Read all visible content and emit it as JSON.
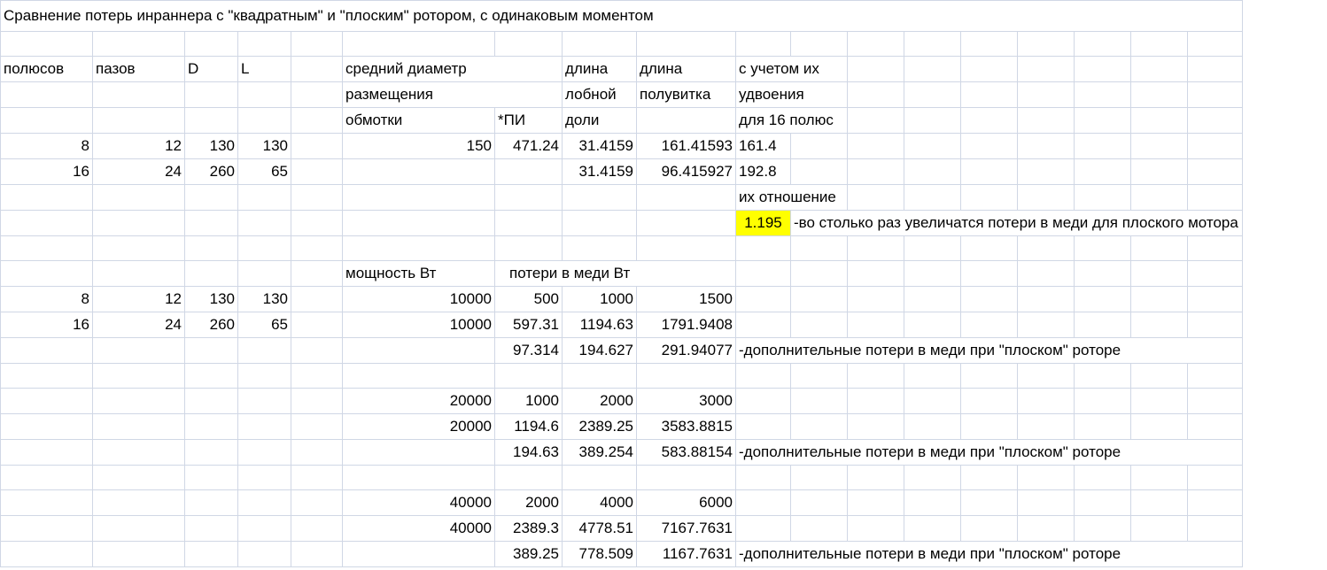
{
  "title": "Сравнение потерь инраннера с \"квадратным\" и \"плоским\" ротором, с одинаковым моментом",
  "headers": {
    "poles": "полюсов",
    "slots": "пазов",
    "d": "D",
    "l": "L",
    "mean_diameter_1": "средний диаметр",
    "mean_diameter_2": "размещения",
    "mean_diameter_3": "обмотки",
    "pi": "*ПИ",
    "len1_1": "длина",
    "len1_2": "лобной",
    "len1_3": "доли",
    "len2_1": "длина",
    "len2_2": "полувитка",
    "double_1": "с учетом их",
    "double_2": "удвоения",
    "double_3": "для 16 полюс"
  },
  "geometry_rows": [
    {
      "poles": "8",
      "slots": "12",
      "d": "130",
      "l": "130",
      "mean_d": "150",
      "pi": "471.24",
      "end_len": "31.4159",
      "half_turn": "161.41593",
      "doubled": "161.4"
    },
    {
      "poles": "16",
      "slots": "24",
      "d": "260",
      "l": "65",
      "mean_d": "",
      "pi": "",
      "end_len": "31.4159",
      "half_turn": "96.415927",
      "doubled": "192.8"
    }
  ],
  "ratio_label": "их отношение",
  "ratio_value": "1.195",
  "ratio_note": "-во столько раз увеличатся потери в меди для плоского мотора",
  "power_header": "мощность Вт",
  "loss_header": "потери в меди Вт",
  "motor_rows": [
    {
      "poles": "8",
      "slots": "12",
      "d": "130",
      "l": "130"
    },
    {
      "poles": "16",
      "slots": "24",
      "d": "260",
      "l": "65"
    }
  ],
  "loss_blocks": [
    {
      "rows": [
        {
          "power": "10000",
          "a": "500",
          "b": "1000",
          "c": "1500"
        },
        {
          "power": "10000",
          "a": "597.31",
          "b": "1194.63",
          "c": "1791.9408"
        },
        {
          "power": "",
          "a": "97.314",
          "b": "194.627",
          "c": "291.94077"
        }
      ],
      "note": "-дополнительные потери в меди при \"плоском\" роторе"
    },
    {
      "rows": [
        {
          "power": "20000",
          "a": "1000",
          "b": "2000",
          "c": "3000"
        },
        {
          "power": "20000",
          "a": "1194.6",
          "b": "2389.25",
          "c": "3583.8815"
        },
        {
          "power": "",
          "a": "194.63",
          "b": "389.254",
          "c": "583.88154"
        }
      ],
      "note": "-дополнительные потери в меди при \"плоском\" роторе"
    },
    {
      "rows": [
        {
          "power": "40000",
          "a": "2000",
          "b": "4000",
          "c": "6000"
        },
        {
          "power": "40000",
          "a": "2389.3",
          "b": "4778.51",
          "c": "7167.7631"
        },
        {
          "power": "",
          "a": "389.25",
          "b": "778.509",
          "c": "1167.7631"
        }
      ],
      "note": "-дополнительные потери в меди при \"плоском\" роторе"
    }
  ]
}
